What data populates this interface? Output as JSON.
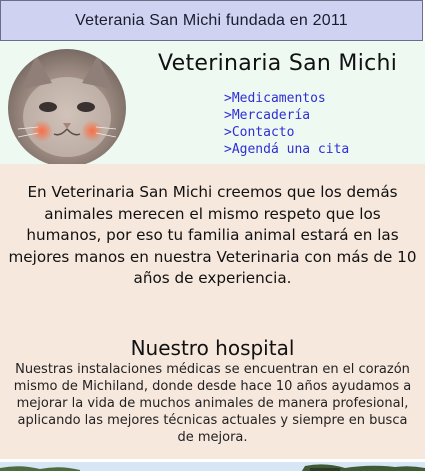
{
  "topbar": {
    "text": "Veterania San Michi fundada en 2011"
  },
  "header": {
    "brand": "Veterinaria San Michi",
    "nav": [
      {
        "label": ">Medicamentos"
      },
      {
        "label": ">Mercadería"
      },
      {
        "label": ">Contacto"
      },
      {
        "label": ">Agendá una cita"
      }
    ]
  },
  "content": {
    "intro": "En Veterinaria San Michi creemos que los demás animales merecen el mismo respeto que los humanos, por eso tu familia animal estará en las mejores manos en nuestra Veterinaria con más de 10 años de experiencia.",
    "hospital_title": "Nuestro hospital",
    "hospital_text": "Nuestras instalaciones médicas se encuentran en el corazón mismo de Michiland, donde desde hace 10 años ayudamos a mejorar la vida de muchos animales de manera profesional, aplicando las mejores técnicas actuales y siempre en busca de mejora."
  },
  "colors": {
    "topbar_bg": "#cfd3f1",
    "header_bg": "#eef9f2",
    "content_bg": "#f7e8de",
    "link": "#2f2fd6"
  }
}
